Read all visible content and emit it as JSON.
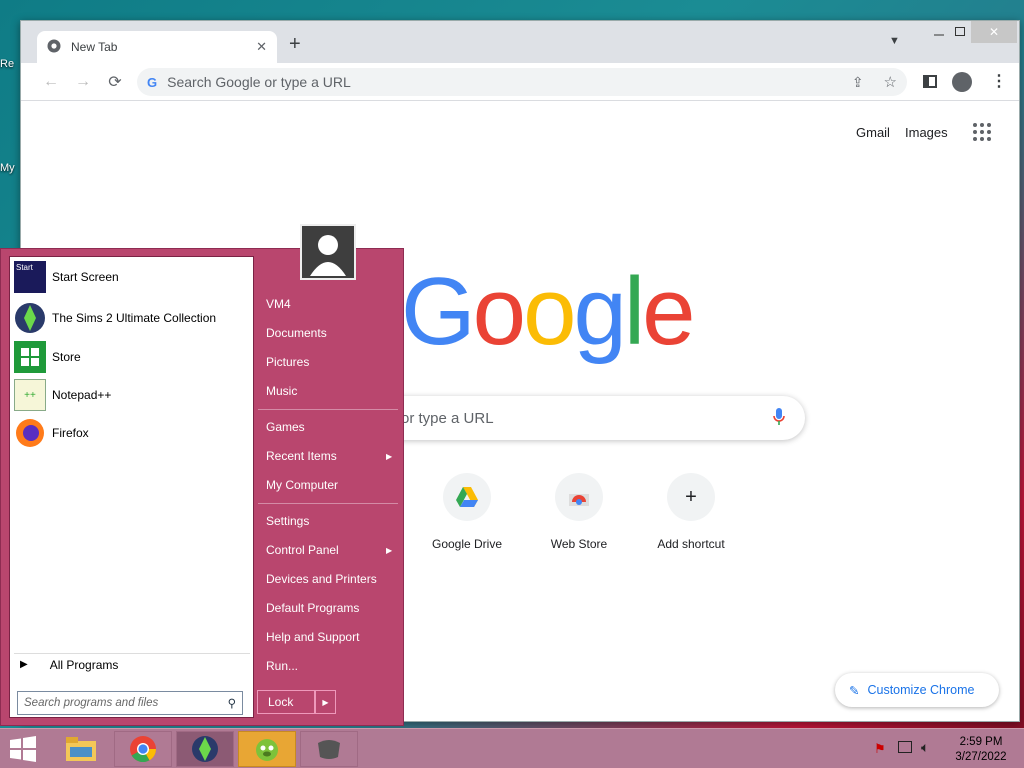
{
  "browser": {
    "tab_title": "New Tab",
    "omnibox_placeholder": "Search Google or type a URL",
    "top_links": [
      "Gmail",
      "Images"
    ],
    "search_placeholder": "Search Google or type a URL",
    "search_visible_text": "or type a URL",
    "logo_text": "Google",
    "shortcuts": [
      {
        "label": "Google Drive",
        "icon": "google-drive-icon"
      },
      {
        "label": "Web Store",
        "icon": "chrome-web-store-icon"
      },
      {
        "label": "Add shortcut",
        "icon": "plus-icon"
      }
    ],
    "customize_label": "Customize Chrome"
  },
  "desktop": {
    "icon_labels": [
      "Re",
      "My"
    ]
  },
  "start_menu": {
    "programs": [
      {
        "label": "Start Screen",
        "icon": "start-screen-icon"
      },
      {
        "label": "The Sims 2 Ultimate Collection",
        "icon": "sims-icon"
      },
      {
        "label": "Store",
        "icon": "store-icon"
      },
      {
        "label": "Notepad++",
        "icon": "notepad-plus-plus-icon"
      },
      {
        "label": "Firefox",
        "icon": "firefox-icon"
      }
    ],
    "all_programs": "All Programs",
    "search_placeholder": "Search programs and files",
    "right_items": [
      "VM4",
      "Documents",
      "Pictures",
      "Music",
      "Games",
      "Recent Items",
      "My Computer",
      "Settings",
      "Control Panel",
      "Devices and Printers",
      "Default Programs",
      "Help and Support",
      "Run..."
    ],
    "lock_label": "Lock"
  },
  "taskbar": {
    "time": "2:59 PM",
    "date": "3/27/2022",
    "pinned": [
      "start-button",
      "file-explorer-icon",
      "chrome-icon",
      "sims-icon",
      "games-icon",
      "unknown-app-icon"
    ]
  },
  "colors": {
    "start_menu_bg": "#b9466e",
    "taskbar_bg": "#b07a94",
    "accent_blue": "#1a73e8"
  }
}
